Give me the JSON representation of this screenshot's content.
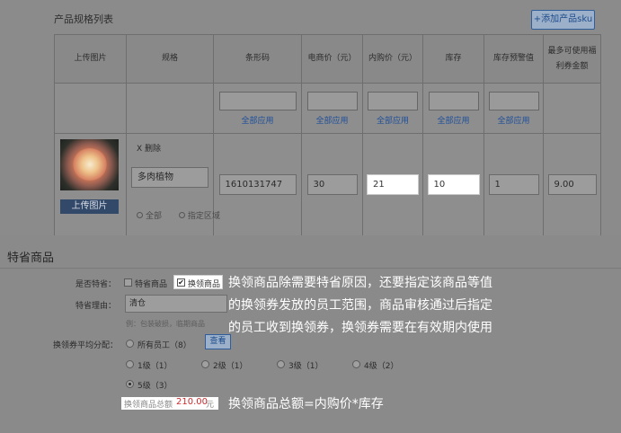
{
  "top": {
    "title": "产品规格列表",
    "add_sku_label": "+添加产品sku"
  },
  "table": {
    "headers": [
      "上传图片",
      "规格",
      "条形码",
      "电商价（元）",
      "内购价（元）",
      "库存",
      "库存预警值",
      "最多可使用福利券金额"
    ],
    "apply_all_label": "全部应用",
    "row": {
      "delete_label": "X 删除",
      "spec_name": "多肉植物",
      "barcode": "1610131747",
      "ecommerce_price": "30",
      "internal_price": "21",
      "stock": "10",
      "stock_warning": "1",
      "max_voucher": "9.00",
      "upload_label": "上传图片",
      "faded_options": [
        "全部",
        "指定区域"
      ]
    }
  },
  "panel": {
    "title": "特省商品",
    "special_label": "是否特省：",
    "special_option_1": "特省商品",
    "special_option_2": "换领商品",
    "reason_label": "特省理由：",
    "reason_value": "清仓",
    "reason_hint": "例：包装破损，临期商品",
    "distribution_label": "换领券平均分配：",
    "all_staff_option": "所有员工（8）",
    "view_label": "查看",
    "levels": [
      "1级（1）",
      "2级（1）",
      "3级（1）",
      "4级（2）",
      "5级（3）"
    ],
    "total_key": "换领商品总额",
    "total_value": "210.00",
    "total_unit": "元"
  },
  "annotations": {
    "line1": "换领商品除需要特省原因，还要指定该商品等值",
    "line2": "的换领券发放的员工范围，商品审核通过后指定",
    "line3": "的员工收到换领券，换领券需要在有效期内使用",
    "formula": "换领商品总额=内购价*库存"
  }
}
